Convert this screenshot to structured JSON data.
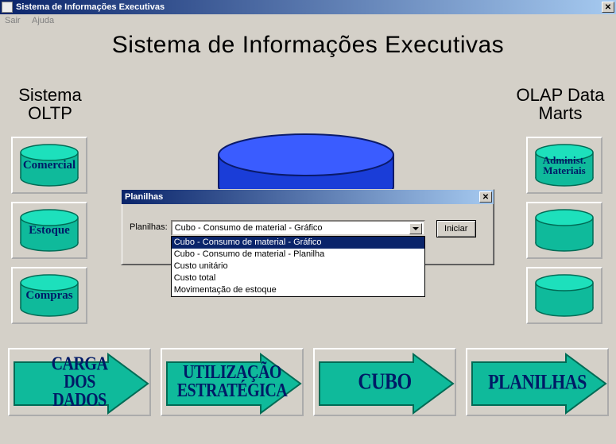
{
  "window": {
    "title": "Sistema de Informações Executivas"
  },
  "menu": {
    "sair": "Sair",
    "ajuda": "Ajuda"
  },
  "page_title": "Sistema de Informações Executivas",
  "left_col": {
    "label": "Sistema\nOLTP"
  },
  "right_col": {
    "label": "OLAP Data\nMarts"
  },
  "oltp": {
    "comercial": "Comercial",
    "estoque": "Estoque",
    "compras": "Compras"
  },
  "olap": {
    "admin": "Administ.\nMateriais"
  },
  "arrows": {
    "a1": "CARGA\nDOS\nDADOS",
    "a2": "UTILIZAÇÃO\nESTRATÉGICA",
    "a3": "CUBO",
    "a4": "PLANILHAS"
  },
  "dialog": {
    "title": "Planilhas",
    "label": "Planilhas:",
    "selected": "Cubo - Consumo de material - Gráfico",
    "iniciar": "Iniciar",
    "options": {
      "o0": "Cubo - Consumo de material - Gráfico",
      "o1": "Cubo - Consumo de material - Planilha",
      "o2": "Custo unitário",
      "o3": "Custo total",
      "o4": "Movimentação de estoque"
    }
  }
}
